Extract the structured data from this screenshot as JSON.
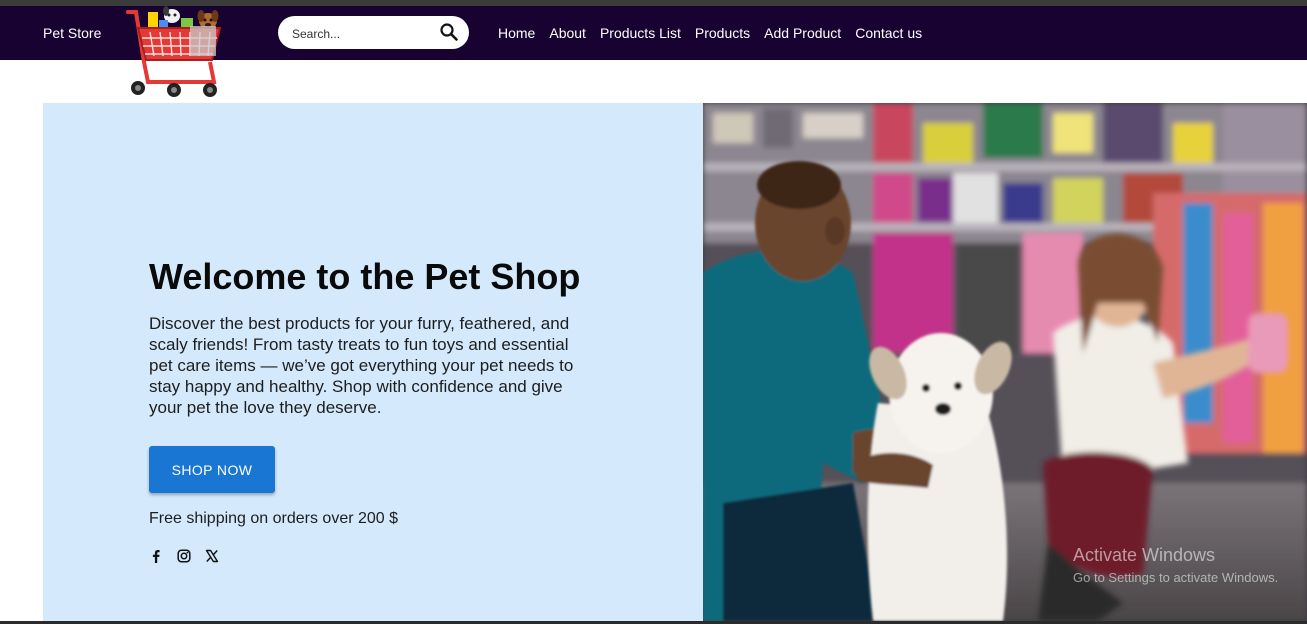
{
  "navbar": {
    "brand": "Pet Store",
    "search": {
      "placeholder": "Search..."
    },
    "links": [
      {
        "label": "Home"
      },
      {
        "label": "About"
      },
      {
        "label": "Products List"
      },
      {
        "label": "Products"
      },
      {
        "label": "Add Product"
      },
      {
        "label": "Contact us"
      }
    ]
  },
  "hero": {
    "title": "Welcome to the Pet Shop",
    "description": "Discover the best products for your furry, feathered, and scaly friends! From tasty treats to fun toys and essential pet care items — we’ve got everything your pet needs to stay happy and healthy. Shop with confidence and give your pet the love they deserve.",
    "cta_label": "SHOP NOW",
    "shipping_note": "Free shipping on orders over 200 $",
    "socials": [
      "facebook-icon",
      "instagram-icon",
      "x-icon"
    ]
  },
  "os_watermark": {
    "title": "Activate Windows",
    "subtitle": "Go to Settings to activate Windows."
  },
  "colors": {
    "navbar_bg": "#170231",
    "hero_bg": "#d4eafc",
    "cta_bg": "#1976d2",
    "cart_red": "#e53935"
  }
}
